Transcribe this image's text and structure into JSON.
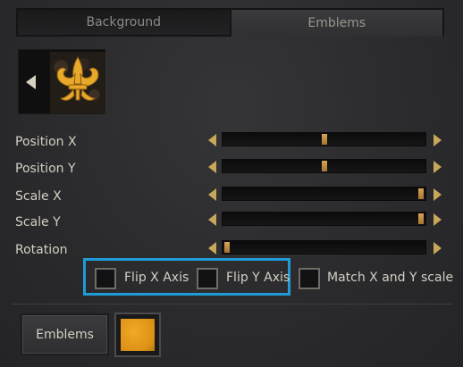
{
  "tabs": [
    {
      "label": "Background",
      "active": false
    },
    {
      "label": "Emblems",
      "active": true
    }
  ],
  "preview": {
    "prev_icon": "triangle-left-icon",
    "emblem_icon": "fleur-de-lis-icon",
    "emblem_color": "#e8a82a"
  },
  "sliders": [
    {
      "label": "Position X",
      "value": 0.5
    },
    {
      "label": "Position Y",
      "value": 0.5
    },
    {
      "label": "Scale X",
      "value": 1.0
    },
    {
      "label": "Scale Y",
      "value": 1.0
    },
    {
      "label": "Rotation",
      "value": 0.0
    }
  ],
  "checkboxes": [
    {
      "label": "Flip X Axis",
      "checked": false
    },
    {
      "label": "Flip Y Axis",
      "checked": false
    },
    {
      "label": "Match X and Y scale",
      "checked": false
    }
  ],
  "bottom": {
    "emblems_button_label": "Emblems",
    "color_swatch": "#e9a01f"
  },
  "colors": {
    "accent_gold": "#c8a65a",
    "highlight_blue": "#1f9cd8"
  }
}
